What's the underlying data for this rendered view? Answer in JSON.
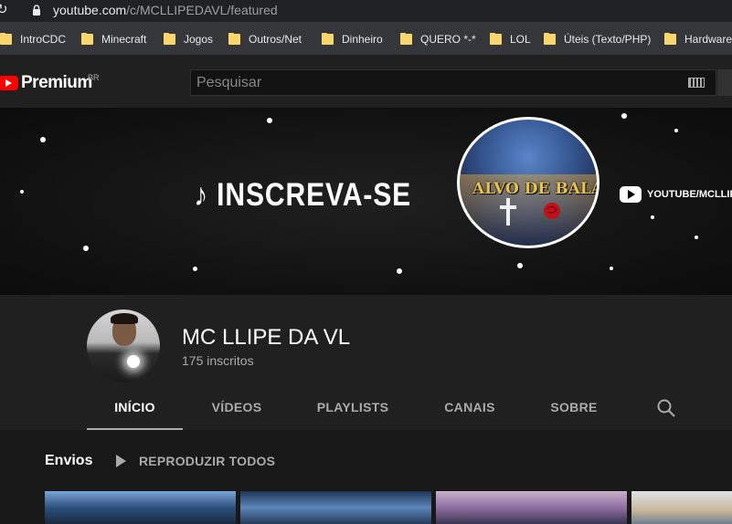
{
  "browser": {
    "url_host": "youtube.com",
    "url_path": "/c/MCLLIPEDAVL/featured",
    "bookmarks": [
      "IntroCDC",
      "Minecraft",
      "Jogos",
      "Outros/Net",
      "Dinheiro",
      "QUERO *-*",
      "LOL",
      "Úteis (Texto/PHP)",
      "Hardware"
    ]
  },
  "masthead": {
    "logo_text": "Premium",
    "region": "BR",
    "search_placeholder": "Pesquisar"
  },
  "banner": {
    "headline": "♪ INSCREVA-SE",
    "disc_title": "ALVO DE BALA",
    "social_handle": "YOUTUBE/MCLLIPEDA"
  },
  "channel": {
    "name": "MC LLIPE DA VL",
    "subscribers": "175 inscritos"
  },
  "tabs": [
    {
      "label": "INÍCIO",
      "active": true
    },
    {
      "label": "VÍDEOS",
      "active": false
    },
    {
      "label": "PLAYLISTS",
      "active": false
    },
    {
      "label": "CANAIS",
      "active": false
    },
    {
      "label": "SOBRE",
      "active": false
    }
  ],
  "shelf": {
    "title": "Envios",
    "play_all": "REPRODUZIR TODOS"
  },
  "colors": {
    "youtube_red": "#ff0000",
    "folder_yellow": "#f9d66d",
    "page_bg": "#181818",
    "header_bg": "#202020"
  }
}
